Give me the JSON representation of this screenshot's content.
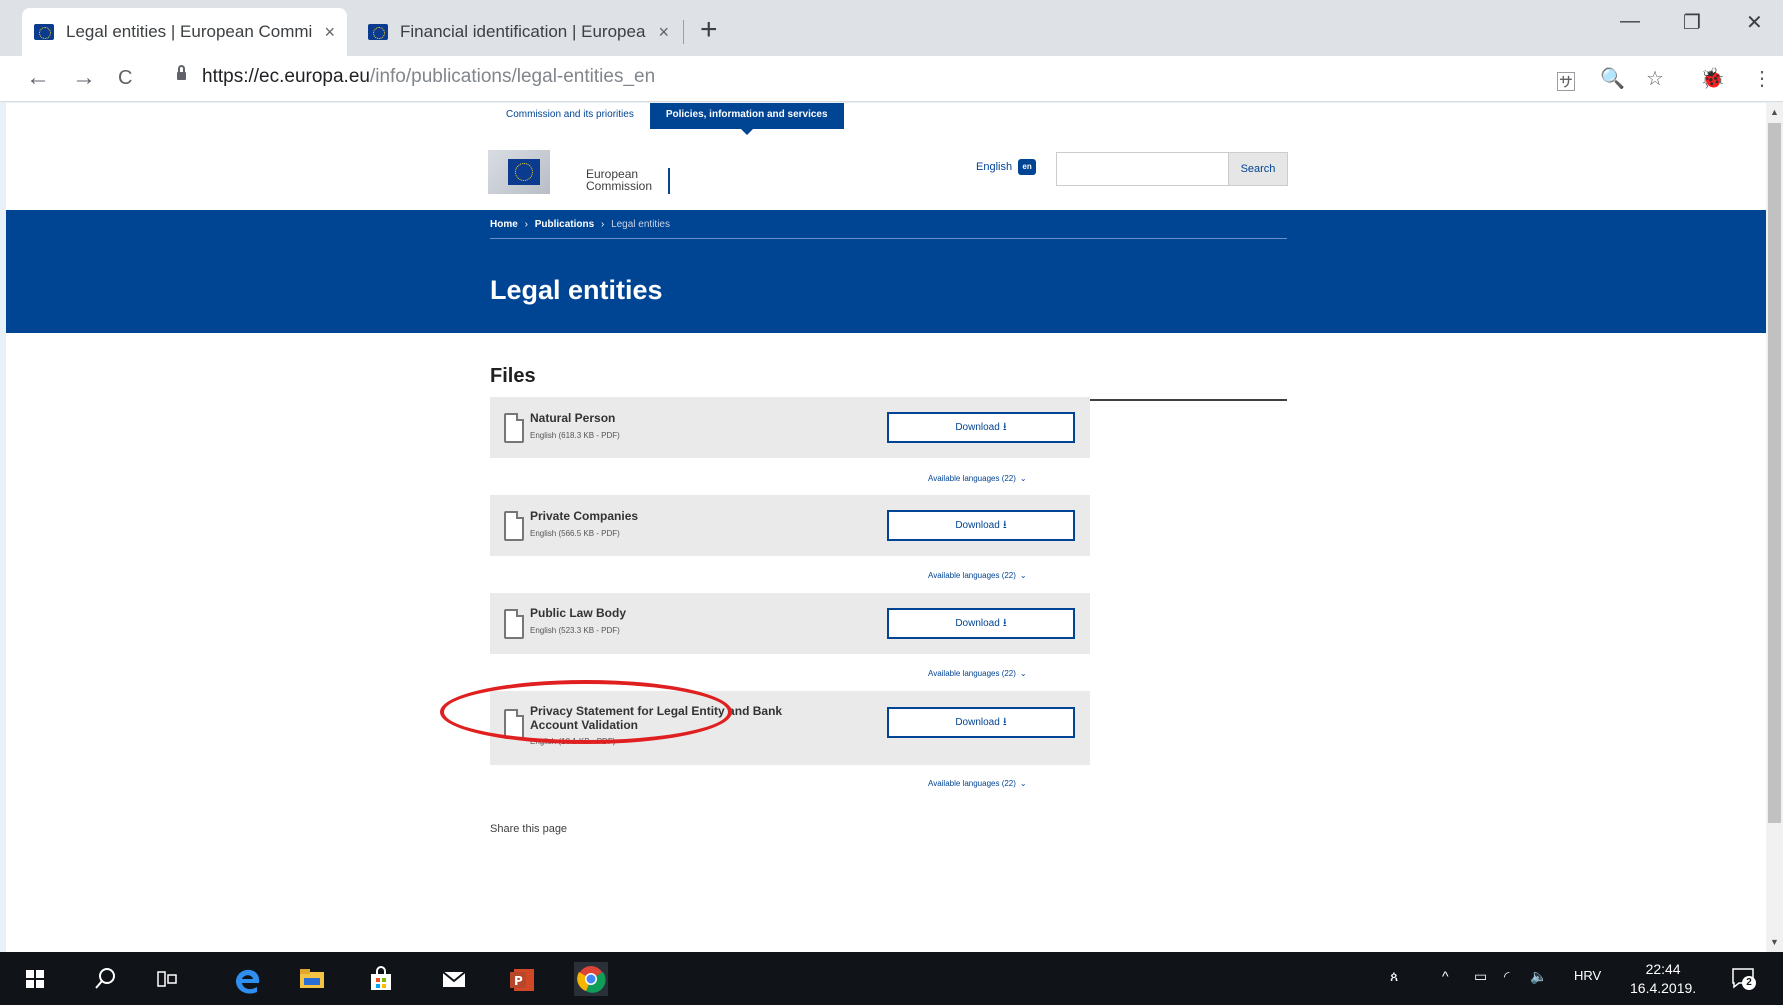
{
  "browser": {
    "tabs": [
      {
        "title": "Legal entities | European Commi",
        "close": "×",
        "active": true
      },
      {
        "title": "Financial identification | Europea",
        "close": "×",
        "active": false
      }
    ],
    "new_tab": "+",
    "window_controls": {
      "minimize": "—",
      "restore": "❐",
      "close": "✕"
    },
    "nav": {
      "back": "←",
      "forward": "→",
      "reload": "C"
    },
    "url_host": "https://ec.europa.eu",
    "url_path": "/info/publications/legal-entities_en",
    "toolbar_icons": {
      "translate": "🈂",
      "zoom": "🔍",
      "bookmark": "☆",
      "profile": "🐞",
      "menu": "⋮"
    }
  },
  "site": {
    "top_nav": [
      "Commission and its priorities",
      "Policies, information and services"
    ],
    "logo": {
      "line1": "European",
      "line2": "Commission"
    },
    "language": {
      "label": "English",
      "code": "en"
    },
    "search": {
      "placeholder": "",
      "button": "Search"
    }
  },
  "breadcrumb": {
    "home": "Home",
    "publications": "Publications",
    "current": "Legal entities",
    "separator": "›"
  },
  "page_title": "Legal entities",
  "files_heading": "Files",
  "files": [
    {
      "name": "Natural Person",
      "meta": "English (618.3 KB - PDF)",
      "download": "Download",
      "download_icon": "⭳",
      "available": "Available languages (22)",
      "chevron": "⌄"
    },
    {
      "name": "Private Companies",
      "meta": "English (566.5 KB - PDF)",
      "download": "Download",
      "download_icon": "⭳",
      "available": "Available languages (22)",
      "chevron": "⌄"
    },
    {
      "name": "Public Law Body",
      "meta": "English (523.3 KB - PDF)",
      "download": "Download",
      "download_icon": "⭳",
      "available": "Available languages (22)",
      "chevron": "⌄"
    },
    {
      "name": "Privacy Statement for Legal Entity and Bank Account Validation",
      "meta": "English (18.1 KB - PDF)",
      "download": "Download",
      "download_icon": "⭳",
      "available": "Available languages (22)",
      "chevron": "⌄"
    }
  ],
  "share": "Share this page",
  "taskbar": {
    "tray": {
      "people": "ጰ",
      "chevron": "^",
      "battery": "▭",
      "wifi": "◜",
      "volume": "🔈",
      "lang": "HRV",
      "notification_count": "2"
    },
    "time": "22:44",
    "date": "16.4.2019."
  },
  "colors": {
    "ec_blue": "#004494",
    "highlight_red": "#e02020"
  }
}
